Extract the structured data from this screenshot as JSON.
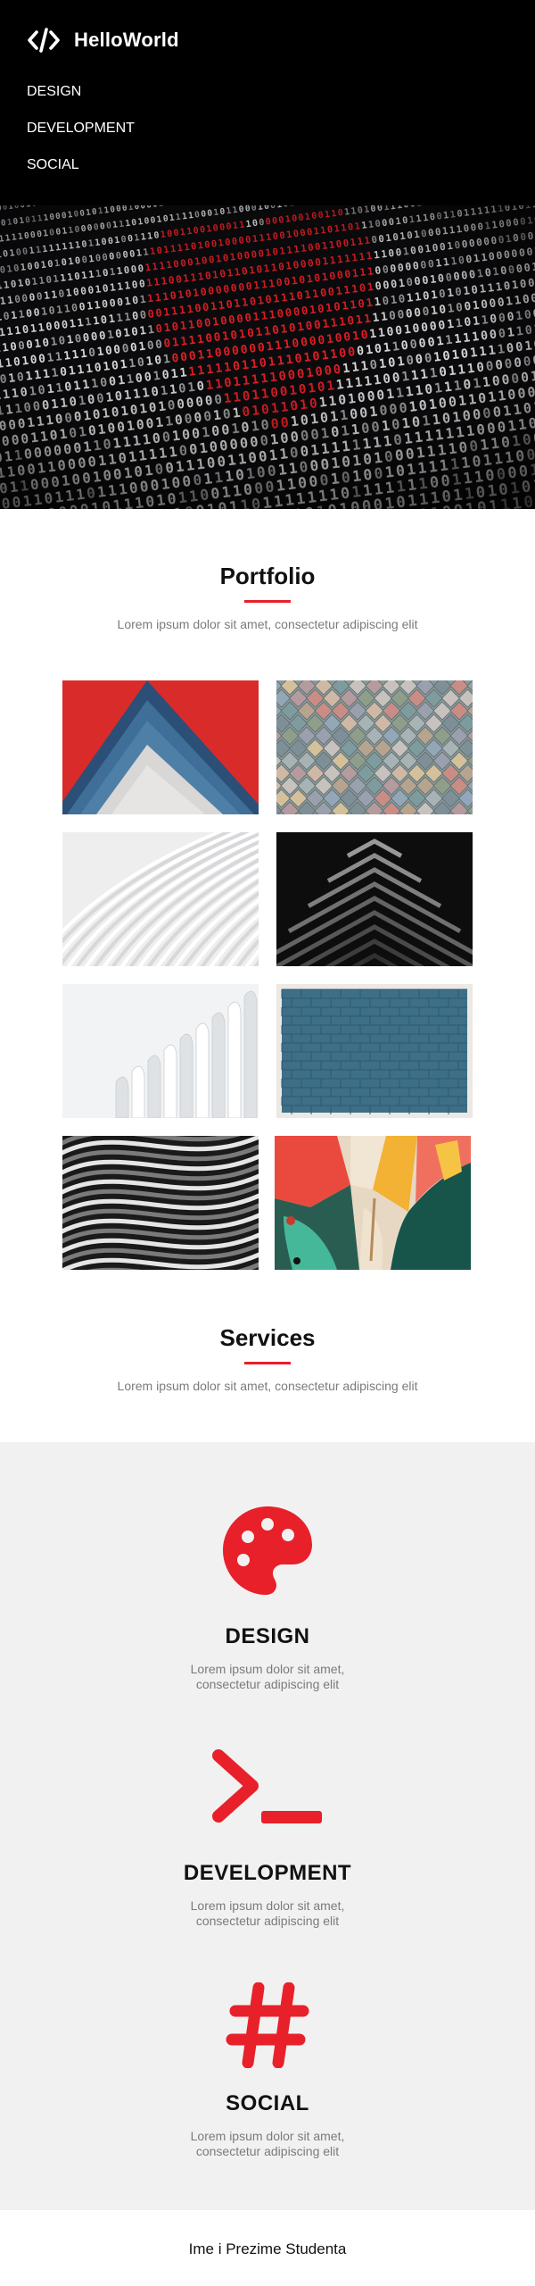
{
  "header": {
    "brand_name": "HelloWorld",
    "brand_icon": "code-brackets-icon",
    "nav": [
      {
        "label": "DESIGN"
      },
      {
        "label": "DEVELOPMENT"
      },
      {
        "label": "SOCIAL"
      }
    ]
  },
  "hero": {
    "image": "binary-code-heart-photo"
  },
  "portfolio": {
    "title": "Portfolio",
    "subtitle": "Lorem ipsum dolor sit amet, consectetur adipiscing elit",
    "images": [
      "red-blue-paper-chevrons",
      "colorful-scale-tiles",
      "white-curved-architecture",
      "dark-chevron-stripes",
      "white-sculpture-fins",
      "blue-painted-brick-wall",
      "grey-curved-louvres",
      "abstract-colorful-painting"
    ]
  },
  "services": {
    "title": "Services",
    "subtitle": "Lorem ipsum dolor sit amet, consectetur adipiscing elit",
    "items": [
      {
        "title": "DESIGN",
        "icon": "palette-icon",
        "desc_line1": "Lorem ipsum dolor sit amet,",
        "desc_line2": "consectetur adipiscing elit"
      },
      {
        "title": "DEVELOPMENT",
        "icon": "terminal-icon",
        "desc_line1": "Lorem ipsum dolor sit amet,",
        "desc_line2": "consectetur adipiscing elit"
      },
      {
        "title": "SOCIAL",
        "icon": "hashtag-icon",
        "desc_line1": "Lorem ipsum dolor sit amet,",
        "desc_line2": "consectetur adipiscing elit"
      }
    ]
  },
  "colors": {
    "accent": "#e8202a",
    "header_bg": "#000000",
    "services_bg": "#f1f1f1",
    "muted_text": "#7b7b7b"
  },
  "footer": {
    "text": "Ime i Prezime Studenta"
  }
}
